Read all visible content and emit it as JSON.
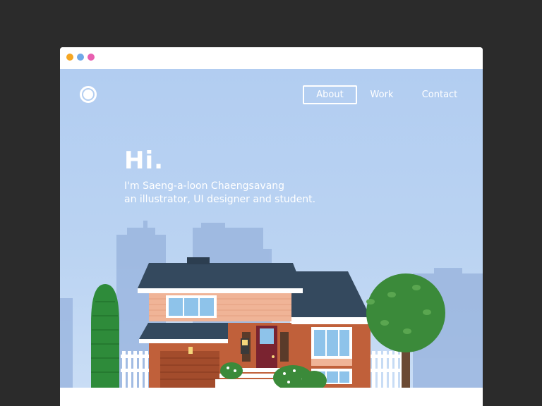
{
  "window": {
    "dots": [
      "#f5a623",
      "#6fa8e8",
      "#e85fb0"
    ]
  },
  "nav": {
    "items": [
      {
        "label": "About",
        "active": true
      },
      {
        "label": "Work",
        "active": false
      },
      {
        "label": "Contact",
        "active": false
      }
    ]
  },
  "hero": {
    "greeting": "Hi.",
    "intro_line1": "I'm Saeng-a-loon Chaengsavang",
    "intro_line2": "an illustrator, UI designer and student."
  },
  "colors": {
    "page_background": "#2b2b2b",
    "sky": "#b2cdf1",
    "skyline": "#9bb6df",
    "roof": "#34495e",
    "brick": "#c0603a",
    "siding": "#f0b497",
    "window_glass": "#8ec3ea",
    "tree_green": "#3b8a3a",
    "cypress_green": "#2e8b3a",
    "fence": "#ffffff"
  }
}
